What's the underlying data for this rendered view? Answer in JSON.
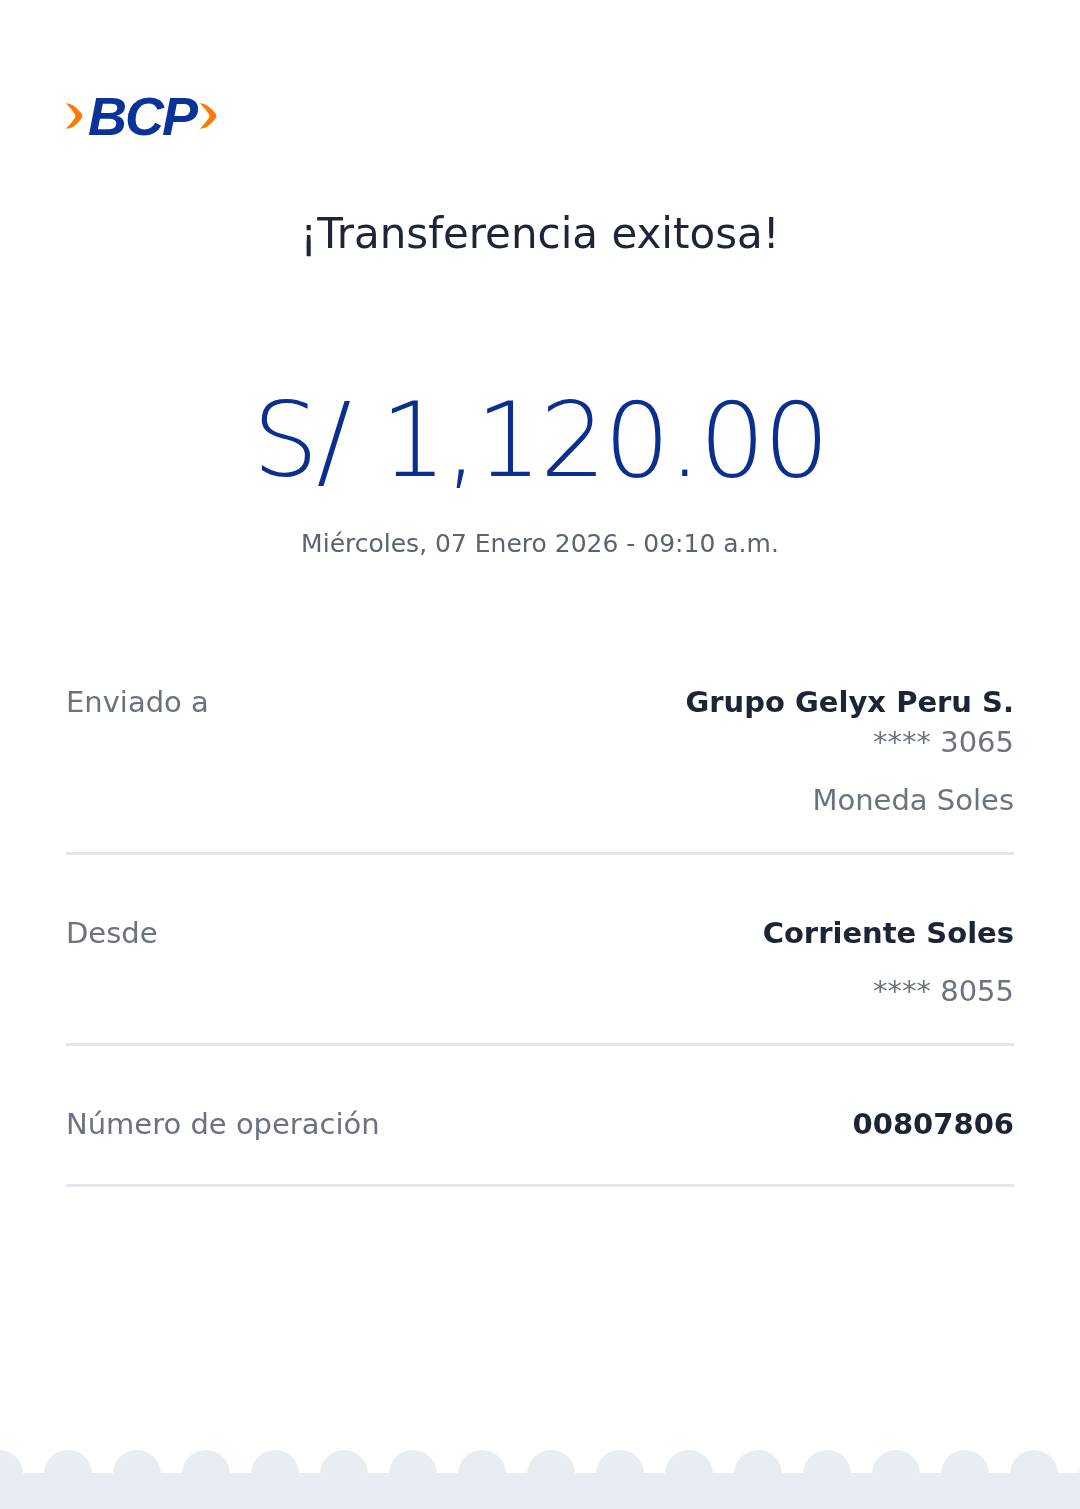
{
  "logo": {
    "text": "BCP"
  },
  "title": "¡Transferencia exitosa!",
  "amount": "S/ 1,120.00",
  "datetime": "Miércoles, 07 Enero 2026 - 09:10 a.m.",
  "details": [
    {
      "label": "Enviado a",
      "values": [
        {
          "text": "Grupo Gelyx Peru S.",
          "kind": "primary"
        },
        {
          "text": "**** 3065",
          "kind": "secondary"
        },
        {
          "text": "Moneda Soles",
          "kind": "note"
        }
      ]
    },
    {
      "label": "Desde",
      "values": [
        {
          "text": "Corriente Soles",
          "kind": "primary"
        },
        {
          "text": "**** 8055",
          "kind": "note"
        }
      ]
    },
    {
      "label": "Número de operación",
      "values": [
        {
          "text": "00807806",
          "kind": "primary"
        }
      ]
    }
  ]
}
